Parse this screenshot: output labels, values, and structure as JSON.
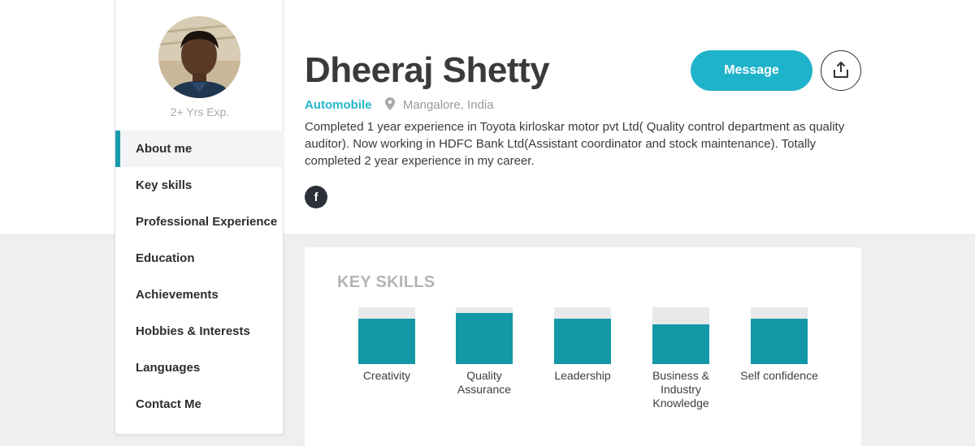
{
  "profile": {
    "name": "Dheeraj Shetty",
    "experience": "2+ Yrs Exp.",
    "industry": "Automobile",
    "location": "Mangalore, India",
    "bio": "Completed 1 year experience in Toyota kirloskar motor pvt Ltd( Quality control department as quality auditor). Now working in HDFC Bank Ltd(Assistant coordinator and stock maintenance). Totally completed 2 year experience in my career.",
    "facebook_label": "f"
  },
  "actions": {
    "message_label": "Message",
    "share_icon": "share-upload-icon"
  },
  "sidebar": {
    "active": "About me",
    "items": [
      {
        "label": "About me"
      },
      {
        "label": "Key skills"
      },
      {
        "label": "Professional Experience"
      },
      {
        "label": "Education"
      },
      {
        "label": "Achievements"
      },
      {
        "label": "Hobbies & Interests"
      },
      {
        "label": "Languages"
      },
      {
        "label": "Contact Me"
      }
    ]
  },
  "skills": {
    "title": "KEY SKILLS",
    "items": [
      {
        "label": "Creativity",
        "level": 0.8
      },
      {
        "label": "Quality Assurance",
        "level": 0.9
      },
      {
        "label": "Leadership",
        "level": 0.8
      },
      {
        "label": "Business & Industry Knowledge",
        "level": 0.7
      },
      {
        "label": "Self confidence",
        "level": 0.8
      }
    ]
  },
  "colors": {
    "accent": "#1fb3cb",
    "bar_fill": "#1398a7",
    "bar_track": "#e9e9ec",
    "industry": "#24b6cc"
  }
}
